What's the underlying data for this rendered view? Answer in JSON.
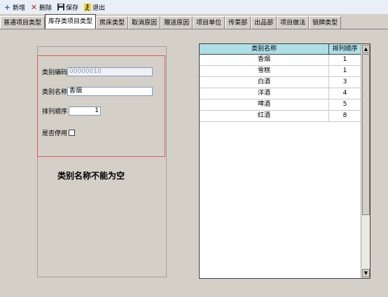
{
  "toolbar": {
    "add_label": "新增",
    "delete_label": "删除",
    "save_label": "保存",
    "exit_label": "退出"
  },
  "tabs": [
    {
      "label": "普通项目类型"
    },
    {
      "label": "库存类项目类型"
    },
    {
      "label": "房床类型"
    },
    {
      "label": "取消原因"
    },
    {
      "label": "赠送原因"
    },
    {
      "label": "项目单位"
    },
    {
      "label": "传菜部"
    },
    {
      "label": "出品部"
    },
    {
      "label": "项目做法"
    },
    {
      "label": "锁牌类型"
    }
  ],
  "form": {
    "code_label": "类别编码",
    "code_value": "00000010",
    "name_label": "类别名称",
    "name_value": "香烟",
    "order_label": "排列顺序",
    "order_value": "1",
    "disabled_label": "是否停用"
  },
  "error_message": "类别名称不能为空",
  "grid": {
    "columns": [
      "类别名称",
      "排列顺序"
    ],
    "rows": [
      [
        "香烟",
        "1"
      ],
      [
        "雪糕",
        "1"
      ],
      [
        "白酒",
        "3"
      ],
      [
        "洋酒",
        "4"
      ],
      [
        "啤酒",
        "5"
      ],
      [
        "红酒",
        "8"
      ]
    ]
  },
  "colors": {
    "toolbar_bg": "#e8eff7",
    "grid_header_bg": "#aedfe9",
    "form_border": "#e05a5a",
    "delete_icon": "#cc2222"
  }
}
